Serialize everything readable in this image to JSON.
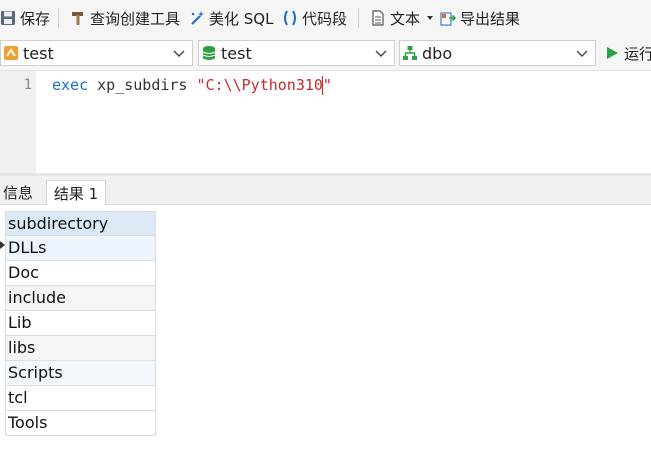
{
  "toolbar": {
    "save_label": "保存",
    "query_builder_label": "查询创建工具",
    "beautify_sql_label": "美化 SQL",
    "code_snippet_label": "代码段",
    "text_label": "文本",
    "export_label": "导出结果"
  },
  "selectors": {
    "connection": "test",
    "database": "test",
    "schema": "dbo",
    "run_label": "运行"
  },
  "editor": {
    "line_number": "1",
    "keyword": "exec",
    "procedure": " xp_subdirs ",
    "argument": "\"C:\\\\Python310\""
  },
  "tabs": {
    "info": "信息",
    "result": "结果 1"
  },
  "results": {
    "column": "subdirectory",
    "rows": [
      "DLLs",
      "Doc",
      "include",
      "Lib",
      "libs",
      "Scripts",
      "tcl",
      "Tools"
    ]
  },
  "colors": {
    "keyword": "#1a6fc9",
    "string": "#c22b2b",
    "header_bg": "#dbe9f6",
    "run_green": "#2ea043"
  }
}
